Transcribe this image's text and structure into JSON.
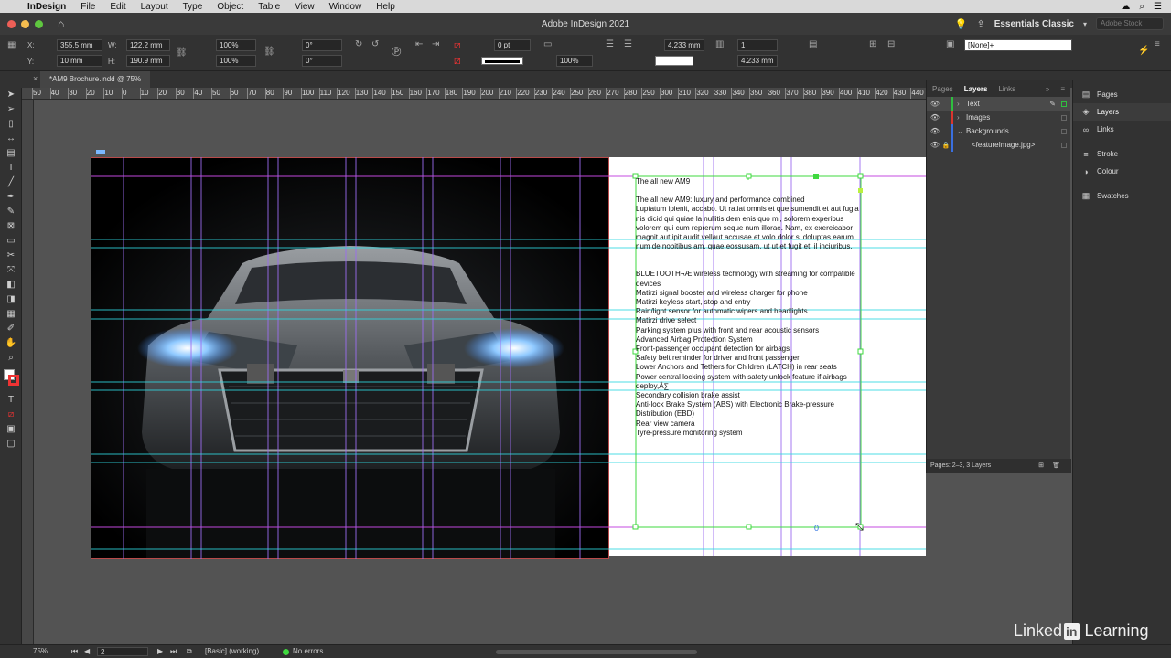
{
  "menubar": {
    "app_name": "InDesign",
    "items": [
      "File",
      "Edit",
      "Layout",
      "Type",
      "Object",
      "Table",
      "View",
      "Window",
      "Help"
    ]
  },
  "window": {
    "title": "Adobe InDesign 2021",
    "workspace": "Essentials Classic",
    "stock_placeholder": "Adobe Stock"
  },
  "control": {
    "x_label": "X:",
    "x_value": "355.5 mm",
    "y_label": "Y:",
    "y_value": "10 mm",
    "w_label": "W:",
    "w_value": "122.2 mm",
    "h_label": "H:",
    "h_value": "190.9 mm",
    "scale_x": "100%",
    "scale_y": "100%",
    "rotate": "0°",
    "shear": "0°",
    "stroke_weight": "0 pt",
    "opacity": "100%",
    "gutter1": "4.233 mm",
    "columns": "1",
    "gutter2": "4.233 mm",
    "style": "[None]+"
  },
  "document": {
    "tab_label": "*AM9 Brochure.indd @ 75%",
    "ruler_ticks": [
      "50",
      "40",
      "30",
      "20",
      "10",
      "0",
      "10",
      "20",
      "30",
      "40",
      "50",
      "60",
      "70",
      "80",
      "90",
      "100",
      "110",
      "120",
      "130",
      "140",
      "150",
      "160",
      "170",
      "180",
      "190",
      "200",
      "210",
      "220",
      "230",
      "240",
      "250",
      "260",
      "270",
      "280",
      "290",
      "300",
      "310",
      "320",
      "330",
      "340",
      "350",
      "360",
      "370",
      "380",
      "390",
      "400",
      "410",
      "420",
      "430",
      "440"
    ]
  },
  "text_frame": {
    "heading": "The all new AM9",
    "intro": "The all new AM9: luxury and performance combined\nLuptatum ipienit, accabo. Ut ratiat omnis et que sumendit et aut fugia nis dicid qui quiae la nullitis dem enis quo mi, solorem experibus volorem qui cum reprerum seque num illorae. Nam, ex exereicabor magnit aut ipit audit vellaut accusae et volo dolor si doluptas earum num de nobitibus am, quae eossusam, ut ut et fugit et, il inciuribus.",
    "features": [
      "BLUETOOTH¬Æ wireless technology with streaming for compatible devices",
      "Matirzi signal booster and wireless charger for phone",
      "Matirzi keyless start, stop and entry",
      "Rain/light sensor for automatic wipers and headlights",
      "Matirzi drive select",
      "Parking system plus with front and rear acoustic sensors",
      "Advanced Airbag Protection System",
      "Front-passenger occupant detection for airbags",
      "Safety belt reminder for driver and front passenger",
      "Lower Anchors and Tethers for Children (LATCH) in rear seats",
      "Power central locking system with safety unlock feature if airbags deploy,Â∑",
      "Secondary collision brake assist",
      "Anti-lock Brake System (ABS) with Electronic Brake-pressure Distribution (EBD)",
      "Rear view camera",
      "Tyre-pressure monitoring system"
    ]
  },
  "layers_panel": {
    "tabs": [
      "Pages",
      "Layers",
      "Links"
    ],
    "active_tab": "Layers",
    "layers": [
      {
        "name": "Text",
        "color": "#2fbf3f"
      },
      {
        "name": "Images",
        "color": "#d9362e"
      },
      {
        "name": "Backgrounds",
        "color": "#3a6fdf"
      },
      {
        "name": "<featureImage.jpg>",
        "color": "#3a6fdf"
      }
    ],
    "footer": "Pages: 2–3, 3 Layers"
  },
  "dock": {
    "items": [
      "Pages",
      "Layers",
      "Links",
      "Stroke",
      "Colour",
      "Swatches"
    ]
  },
  "status": {
    "zoom": "75%",
    "page": "2",
    "profile": "[Basic] (working)",
    "preflight": "No errors"
  },
  "branding": {
    "linked": "Linked",
    "in": "in",
    "learning": "Learning"
  }
}
